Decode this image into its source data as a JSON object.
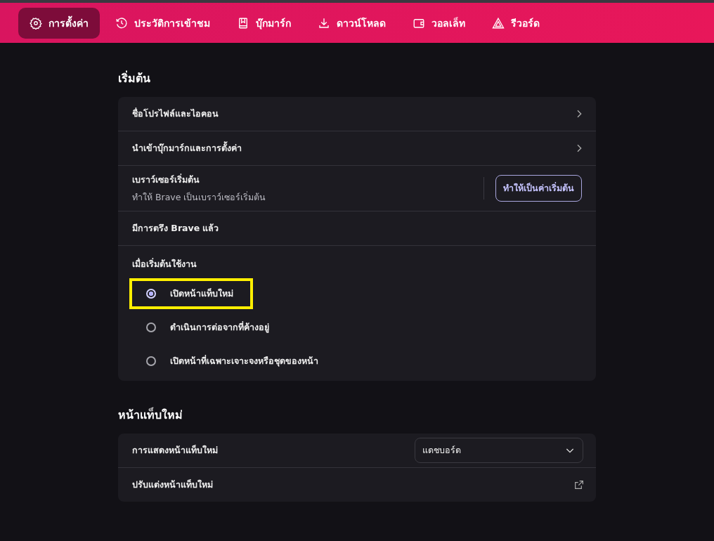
{
  "nav": [
    {
      "label": "การตั้งค่า",
      "selected": true
    },
    {
      "label": "ประวัติการเข้าชม",
      "selected": false
    },
    {
      "label": "บุ๊กมาร์ก",
      "selected": false
    },
    {
      "label": "ดาวน์โหลด",
      "selected": false
    },
    {
      "label": "วอลเล็ท",
      "selected": false
    },
    {
      "label": "รีวอร์ด",
      "selected": false
    }
  ],
  "sections": [
    {
      "title": "เริ่มต้น",
      "rows": [
        {
          "kind": "link",
          "label": "ชื่อโปรไฟล์และไอคอน"
        },
        {
          "kind": "link",
          "label": "นำเข้าบุ๊กมาร์กและการตั้งค่า"
        },
        {
          "kind": "button",
          "label": "เบราว์เซอร์เริ่มต้น",
          "sublabel": "ทำให้ Brave เป็นเบราว์เซอร์เริ่มต้น",
          "button": "ทำให้เป็นค่าเริ่มต้น"
        },
        {
          "kind": "text",
          "label": "มีการตรึง Brave แล้ว"
        },
        {
          "kind": "radio",
          "label": "เมื่อเริ่มต้นใช้งาน",
          "options": [
            {
              "label": "เปิดหน้าแท็บใหม่",
              "selected": true,
              "highlighted": true
            },
            {
              "label": "ดำเนินการต่อจากที่ค้างอยู่",
              "selected": false,
              "highlighted": false
            },
            {
              "label": "เปิดหน้าที่เฉพาะเจาะจงหรือชุดของหน้า",
              "selected": false,
              "highlighted": false
            }
          ]
        }
      ]
    },
    {
      "title": "หน้าแท็บใหม่",
      "rows": [
        {
          "kind": "select",
          "label": "การแสดงหน้าแท็บใหม่",
          "value": "แดชบอร์ด"
        },
        {
          "kind": "external",
          "label": "ปรับแต่งหน้าแท็บใหม่"
        }
      ]
    }
  ]
}
